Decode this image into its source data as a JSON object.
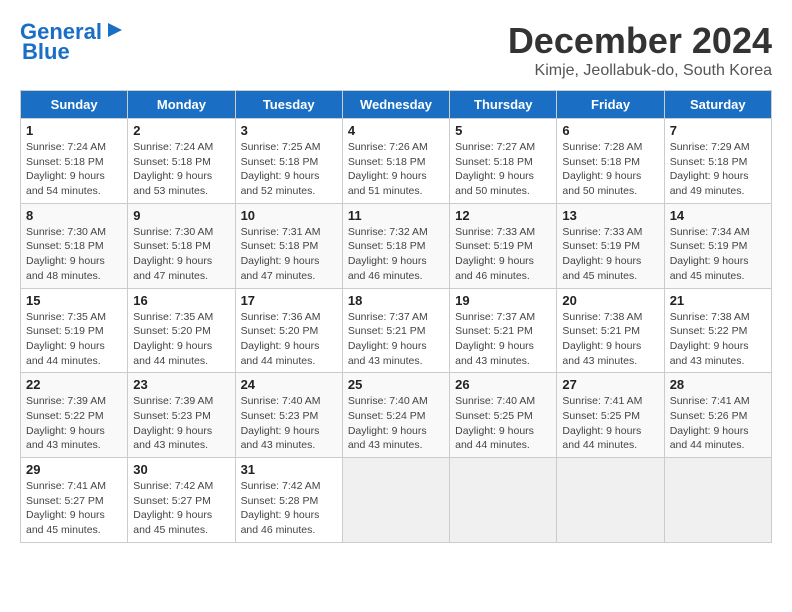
{
  "header": {
    "logo_line1": "General",
    "logo_line2": "Blue",
    "month": "December 2024",
    "location": "Kimje, Jeollabuk-do, South Korea"
  },
  "weekdays": [
    "Sunday",
    "Monday",
    "Tuesday",
    "Wednesday",
    "Thursday",
    "Friday",
    "Saturday"
  ],
  "weeks": [
    [
      {
        "day": "1",
        "info": "Sunrise: 7:24 AM\nSunset: 5:18 PM\nDaylight: 9 hours\nand 54 minutes."
      },
      {
        "day": "2",
        "info": "Sunrise: 7:24 AM\nSunset: 5:18 PM\nDaylight: 9 hours\nand 53 minutes."
      },
      {
        "day": "3",
        "info": "Sunrise: 7:25 AM\nSunset: 5:18 PM\nDaylight: 9 hours\nand 52 minutes."
      },
      {
        "day": "4",
        "info": "Sunrise: 7:26 AM\nSunset: 5:18 PM\nDaylight: 9 hours\nand 51 minutes."
      },
      {
        "day": "5",
        "info": "Sunrise: 7:27 AM\nSunset: 5:18 PM\nDaylight: 9 hours\nand 50 minutes."
      },
      {
        "day": "6",
        "info": "Sunrise: 7:28 AM\nSunset: 5:18 PM\nDaylight: 9 hours\nand 50 minutes."
      },
      {
        "day": "7",
        "info": "Sunrise: 7:29 AM\nSunset: 5:18 PM\nDaylight: 9 hours\nand 49 minutes."
      }
    ],
    [
      {
        "day": "8",
        "info": "Sunrise: 7:30 AM\nSunset: 5:18 PM\nDaylight: 9 hours\nand 48 minutes."
      },
      {
        "day": "9",
        "info": "Sunrise: 7:30 AM\nSunset: 5:18 PM\nDaylight: 9 hours\nand 47 minutes."
      },
      {
        "day": "10",
        "info": "Sunrise: 7:31 AM\nSunset: 5:18 PM\nDaylight: 9 hours\nand 47 minutes."
      },
      {
        "day": "11",
        "info": "Sunrise: 7:32 AM\nSunset: 5:18 PM\nDaylight: 9 hours\nand 46 minutes."
      },
      {
        "day": "12",
        "info": "Sunrise: 7:33 AM\nSunset: 5:19 PM\nDaylight: 9 hours\nand 46 minutes."
      },
      {
        "day": "13",
        "info": "Sunrise: 7:33 AM\nSunset: 5:19 PM\nDaylight: 9 hours\nand 45 minutes."
      },
      {
        "day": "14",
        "info": "Sunrise: 7:34 AM\nSunset: 5:19 PM\nDaylight: 9 hours\nand 45 minutes."
      }
    ],
    [
      {
        "day": "15",
        "info": "Sunrise: 7:35 AM\nSunset: 5:19 PM\nDaylight: 9 hours\nand 44 minutes."
      },
      {
        "day": "16",
        "info": "Sunrise: 7:35 AM\nSunset: 5:20 PM\nDaylight: 9 hours\nand 44 minutes."
      },
      {
        "day": "17",
        "info": "Sunrise: 7:36 AM\nSunset: 5:20 PM\nDaylight: 9 hours\nand 44 minutes."
      },
      {
        "day": "18",
        "info": "Sunrise: 7:37 AM\nSunset: 5:21 PM\nDaylight: 9 hours\nand 43 minutes."
      },
      {
        "day": "19",
        "info": "Sunrise: 7:37 AM\nSunset: 5:21 PM\nDaylight: 9 hours\nand 43 minutes."
      },
      {
        "day": "20",
        "info": "Sunrise: 7:38 AM\nSunset: 5:21 PM\nDaylight: 9 hours\nand 43 minutes."
      },
      {
        "day": "21",
        "info": "Sunrise: 7:38 AM\nSunset: 5:22 PM\nDaylight: 9 hours\nand 43 minutes."
      }
    ],
    [
      {
        "day": "22",
        "info": "Sunrise: 7:39 AM\nSunset: 5:22 PM\nDaylight: 9 hours\nand 43 minutes."
      },
      {
        "day": "23",
        "info": "Sunrise: 7:39 AM\nSunset: 5:23 PM\nDaylight: 9 hours\nand 43 minutes."
      },
      {
        "day": "24",
        "info": "Sunrise: 7:40 AM\nSunset: 5:23 PM\nDaylight: 9 hours\nand 43 minutes."
      },
      {
        "day": "25",
        "info": "Sunrise: 7:40 AM\nSunset: 5:24 PM\nDaylight: 9 hours\nand 43 minutes."
      },
      {
        "day": "26",
        "info": "Sunrise: 7:40 AM\nSunset: 5:25 PM\nDaylight: 9 hours\nand 44 minutes."
      },
      {
        "day": "27",
        "info": "Sunrise: 7:41 AM\nSunset: 5:25 PM\nDaylight: 9 hours\nand 44 minutes."
      },
      {
        "day": "28",
        "info": "Sunrise: 7:41 AM\nSunset: 5:26 PM\nDaylight: 9 hours\nand 44 minutes."
      }
    ],
    [
      {
        "day": "29",
        "info": "Sunrise: 7:41 AM\nSunset: 5:27 PM\nDaylight: 9 hours\nand 45 minutes."
      },
      {
        "day": "30",
        "info": "Sunrise: 7:42 AM\nSunset: 5:27 PM\nDaylight: 9 hours\nand 45 minutes."
      },
      {
        "day": "31",
        "info": "Sunrise: 7:42 AM\nSunset: 5:28 PM\nDaylight: 9 hours\nand 46 minutes."
      },
      null,
      null,
      null,
      null
    ]
  ]
}
